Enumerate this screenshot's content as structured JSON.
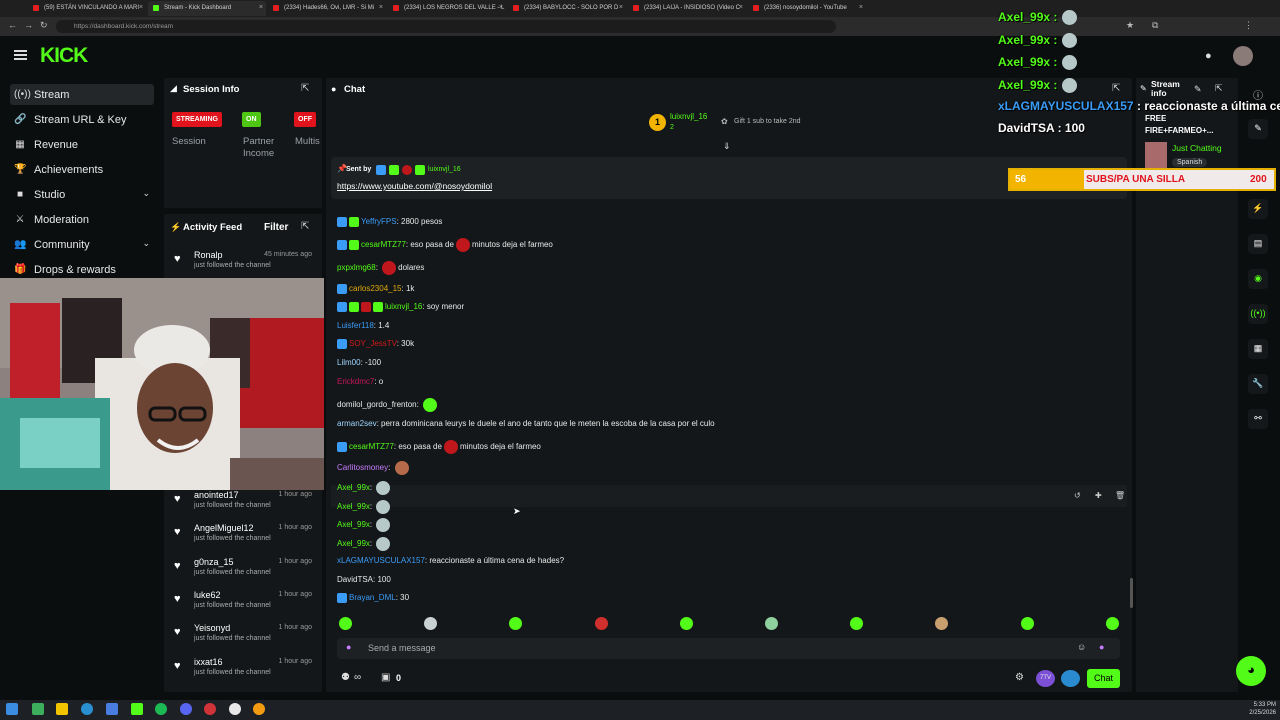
{
  "browser": {
    "tabs": [
      {
        "label": "(59) ESTÁN VINCULANDO A MARI",
        "kind": "yt"
      },
      {
        "label": "Stream - Kick Dashboard",
        "kind": "kick",
        "active": true
      },
      {
        "label": "(2334) Hades66, Ovi, LMR - Si Mi",
        "kind": "yt"
      },
      {
        "label": "(2334) LOS NEGROS DEL VALLE - L",
        "kind": "yt"
      },
      {
        "label": "(2334) BABYLOCC - SOLO POR D",
        "kind": "yt"
      },
      {
        "label": "(2334) LAIJA - INSIDIOSO (Video C",
        "kind": "yt"
      },
      {
        "label": "(2336) nosoydomilol - YouTube",
        "kind": "yt"
      }
    ],
    "url": "https://dashboard.kick.com/stream"
  },
  "header": {
    "logo": "KICK"
  },
  "sidebar": {
    "items": [
      {
        "label": "Stream",
        "icon": "stream-icon",
        "glyph": "((•))"
      },
      {
        "label": "Stream URL & Key",
        "icon": "link-icon",
        "glyph": "🔗"
      },
      {
        "label": "Revenue",
        "icon": "revenue-icon",
        "glyph": "▦"
      },
      {
        "label": "Achievements",
        "icon": "trophy-icon",
        "glyph": "🏆"
      },
      {
        "label": "Studio",
        "icon": "studio-icon",
        "glyph": "■",
        "chevron": true
      },
      {
        "label": "Moderation",
        "icon": "sword-icon",
        "glyph": "⚔"
      },
      {
        "label": "Community",
        "icon": "community-icon",
        "glyph": "👥",
        "chevron": true
      },
      {
        "label": "Drops & rewards",
        "icon": "gift-icon",
        "glyph": "🎁"
      }
    ]
  },
  "session": {
    "title": "Session Info",
    "streaming": "STREAMING",
    "on": "ON",
    "off": "OFF",
    "labels": [
      "Session",
      "Partner Income",
      "Multis"
    ]
  },
  "activity": {
    "title": "Activity Feed",
    "filter": "Filter",
    "items": [
      {
        "name": "Ronalp",
        "time": "45 minutes ago",
        "desc": "just followed the channel"
      },
      {
        "name": "anointed17",
        "time": "1 hour ago",
        "desc": "just followed the channel"
      },
      {
        "name": "AngelMiguel12",
        "time": "1 hour ago",
        "desc": "just followed the channel"
      },
      {
        "name": "g0nza_15",
        "time": "1 hour ago",
        "desc": "just followed the channel"
      },
      {
        "name": "luke62",
        "time": "1 hour ago",
        "desc": "just followed the channel"
      },
      {
        "name": "Yeisonyd",
        "time": "1 hour ago",
        "desc": "just followed the channel"
      },
      {
        "name": "ixxat16",
        "time": "1 hour ago",
        "desc": "just followed the channel"
      }
    ]
  },
  "chat": {
    "title": "Chat",
    "gift": {
      "user": "luixnvjl_16",
      "count": "2",
      "text": "Gift 1 sub to take 2nd"
    },
    "pinned": {
      "sent_by": "Sent by",
      "user": "luixnvjl_16",
      "link": "https://www.youtube.com/@nosoydomilol"
    },
    "messages": [
      {
        "user": "YeffryFPS",
        "text": "2800 pesos",
        "color": "#3b9cf7",
        "badges": 2
      },
      {
        "user": "cesarMTZ77",
        "text": "eso pasa de",
        "after": "minutos deja el farmeo",
        "emote": "#c0171c",
        "color": "#53fc18",
        "badges": 2
      },
      {
        "user": "pxpxlmg68",
        "text": "",
        "after": "dolares",
        "emote": "#c0171c",
        "color": "#53fc18"
      },
      {
        "user": "carlos2304_15",
        "text": "1k",
        "color": "#e0a80a",
        "badges": 1
      },
      {
        "user": "luixnvjl_16",
        "text": "soy menor",
        "color": "#53fc18",
        "badges": 4
      },
      {
        "user": "Luisfer118",
        "text": "1.4",
        "color": "#3b9cf7"
      },
      {
        "user": "SOY_JessTV",
        "text": "30k",
        "color": "#d01a1a",
        "badges": 1
      },
      {
        "user": "Lilm00",
        "text": "-100",
        "color": "#9fd6ff"
      },
      {
        "user": "Erickdmc7",
        "text": "o",
        "color": "#c2185b"
      },
      {
        "user": "domilol_gordo_frenton",
        "text": "",
        "emote": "#53fc18",
        "color": "#e8e8e8"
      },
      {
        "user": "arman2sev",
        "text": "perra dominicana leurys le duele el ano de tanto que le meten la escoba de la casa por el culo",
        "color": "#9fd6ff"
      },
      {
        "user": "cesarMTZ77",
        "text": "eso pasa de",
        "after": "minutos deja el farmeo",
        "emote": "#c0171c",
        "color": "#53fc18",
        "badges": 1
      },
      {
        "user": "Carlitosmoney",
        "text": "",
        "emote": "#b56b4a",
        "color": "#c77dff"
      },
      {
        "user": "Axel_99x",
        "text": "",
        "emote": "#b7c8c8",
        "color": "#53fc18"
      },
      {
        "user": "Axel_99x",
        "text": "",
        "emote": "#b7c8c8",
        "color": "#53fc18"
      },
      {
        "user": "Axel_99x",
        "text": "",
        "emote": "#b7c8c8",
        "color": "#53fc18"
      },
      {
        "user": "Axel_99x",
        "text": "",
        "emote": "#b7c8c8",
        "color": "#53fc18"
      },
      {
        "user": "xLAGMAYUSCULAX157",
        "text": "reaccionaste a última cena de hades?",
        "color": "#3b9cf7"
      },
      {
        "user": "DavidTSA",
        "text": "100",
        "color": "#e8e8e8"
      },
      {
        "user": "Brayan_DML",
        "text": "30",
        "color": "#3b9cf7",
        "badges": 1
      }
    ],
    "placeholder": "Send a message",
    "viewers": "0",
    "send": "Chat",
    "emote_colors": [
      "#53fc18",
      "#c9d1d1",
      "#53fc18",
      "#d0302d",
      "#53fc18",
      "#8fd19e",
      "#53fc18",
      "#c8a070",
      "#53fc18",
      "#53fc18"
    ]
  },
  "overlay": {
    "lines": [
      {
        "text": "Axel_99x :",
        "color": "#53fc18"
      },
      {
        "text": "Axel_99x :",
        "color": "#53fc18"
      },
      {
        "text": "Axel_99x :",
        "color": "#53fc18"
      },
      {
        "text": "Axel_99x :",
        "color": "#53fc18"
      }
    ],
    "xlag": "xLAGMAYUSCULAX157",
    "xlag_msg": ": reaccionaste a última cena",
    "david": "DavidTSA : 100",
    "goal_count": "56",
    "goal_text": "SUBS/PA UNA SILLA",
    "goal_total": "200"
  },
  "stream_info": {
    "title": "Stream info",
    "stream_title": "FREE FIRE+FARMEO+...",
    "category": "Just Chatting",
    "language": "Spanish"
  },
  "taskbar": {
    "time": "5:33 PM",
    "date": "2/25/2026"
  }
}
